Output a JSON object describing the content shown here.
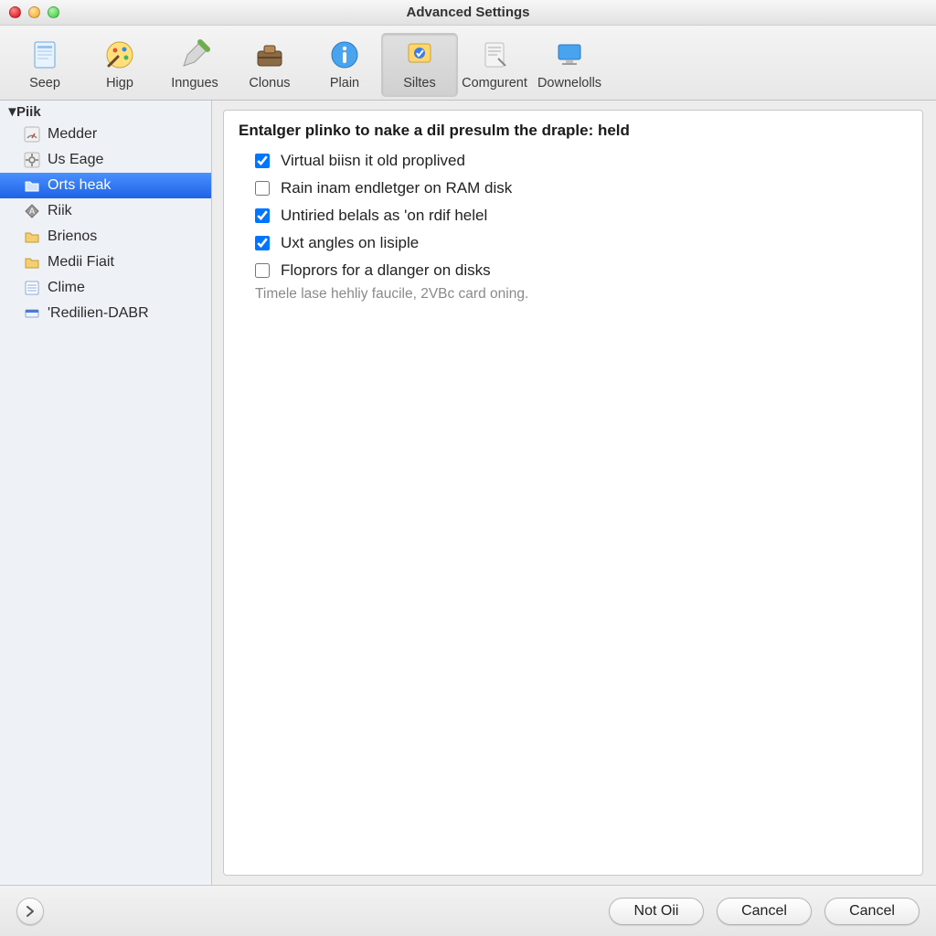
{
  "window": {
    "title": "Advanced Settings"
  },
  "toolbar": {
    "items": [
      {
        "label": "Seep",
        "icon": "doc-icon",
        "active": false
      },
      {
        "label": "Higp",
        "icon": "palette-icon",
        "active": false
      },
      {
        "label": "Inngues",
        "icon": "pencil-icon",
        "active": false
      },
      {
        "label": "Clonus",
        "icon": "toolbox-icon",
        "active": false
      },
      {
        "label": "Plain",
        "icon": "info-icon",
        "active": false
      },
      {
        "label": "Siltes",
        "icon": "shield-icon",
        "active": true
      },
      {
        "label": "Comgurent",
        "icon": "page-icon",
        "active": false
      },
      {
        "label": "Downelolls",
        "icon": "monitor-icon",
        "active": false
      }
    ]
  },
  "sidebar": {
    "root_label": "Piik",
    "items": [
      {
        "label": "Medder",
        "icon": "gauge-icon",
        "selected": false
      },
      {
        "label": "Us Eage",
        "icon": "gear-icon",
        "selected": false
      },
      {
        "label": "Orts heak",
        "icon": "folder-icon",
        "selected": true
      },
      {
        "label": "Riik",
        "icon": "tag-icon",
        "selected": false
      },
      {
        "label": "Brienos",
        "icon": "folder2-icon",
        "selected": false
      },
      {
        "label": "Medii Fiait",
        "icon": "folder2-icon",
        "selected": false
      },
      {
        "label": "Clime",
        "icon": "list-icon",
        "selected": false
      },
      {
        "label": "'Redilien-DABR",
        "icon": "drive-icon",
        "selected": false
      }
    ]
  },
  "panel": {
    "heading": "Entalger plinko to nake a dil presulm the draple: held",
    "options": [
      {
        "label": "Virtual biisn it old proplived",
        "checked": true
      },
      {
        "label": "Rain inam endletger on RAM disk",
        "checked": false
      },
      {
        "label": "Untiried belals as 'on rdif helel",
        "checked": true
      },
      {
        "label": "Uxt angles on lisiple",
        "checked": true
      },
      {
        "label": "Floprors for a dlanger on disks",
        "checked": false
      }
    ],
    "hint_text": "Timele lase hehliy faucile, 2VBc card oning."
  },
  "footer": {
    "buttons": [
      {
        "label": "Not Oii"
      },
      {
        "label": "Cancel"
      },
      {
        "label": "Cancel"
      }
    ]
  }
}
